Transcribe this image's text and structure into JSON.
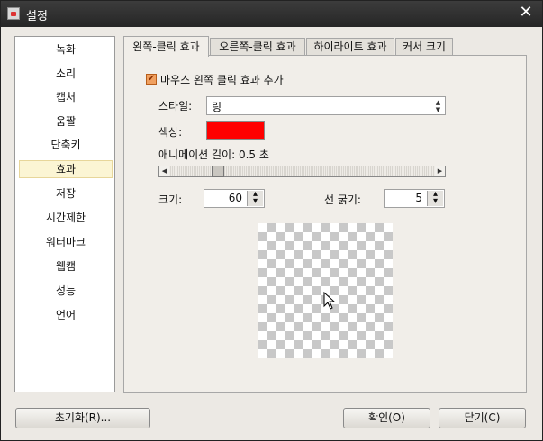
{
  "window": {
    "title": "설정",
    "close_glyph": "✕"
  },
  "sidebar": {
    "items": [
      {
        "label": "녹화"
      },
      {
        "label": "소리"
      },
      {
        "label": "캡처"
      },
      {
        "label": "움짤"
      },
      {
        "label": "단축키"
      },
      {
        "label": "효과",
        "selected": true
      },
      {
        "label": "저장"
      },
      {
        "label": "시간제한"
      },
      {
        "label": "워터마크"
      },
      {
        "label": "웹캠"
      },
      {
        "label": "성능"
      },
      {
        "label": "언어"
      }
    ]
  },
  "tabs": [
    {
      "label": "왼쪽-클릭 효과",
      "active": true
    },
    {
      "label": "오른쪽-클릭 효과"
    },
    {
      "label": "하이라이트 효과"
    },
    {
      "label": "커서 크기"
    }
  ],
  "panel": {
    "checkbox_label": "마우스 왼쪽 클릭 효과 추가",
    "checkbox_checked": true,
    "style_label": "스타일:",
    "style_value": "링",
    "color_label": "색상:",
    "color_value": "#ff0000",
    "animation_label": "애니메이션 길이: 0.5 초",
    "animation_value_seconds": 0.5,
    "size_label": "크기:",
    "size_value": "60",
    "line_label": "선 굵기:",
    "line_value": "5"
  },
  "buttons": {
    "reset": "초기화(R)...",
    "ok": "확인(O)",
    "close": "닫기(C)"
  }
}
